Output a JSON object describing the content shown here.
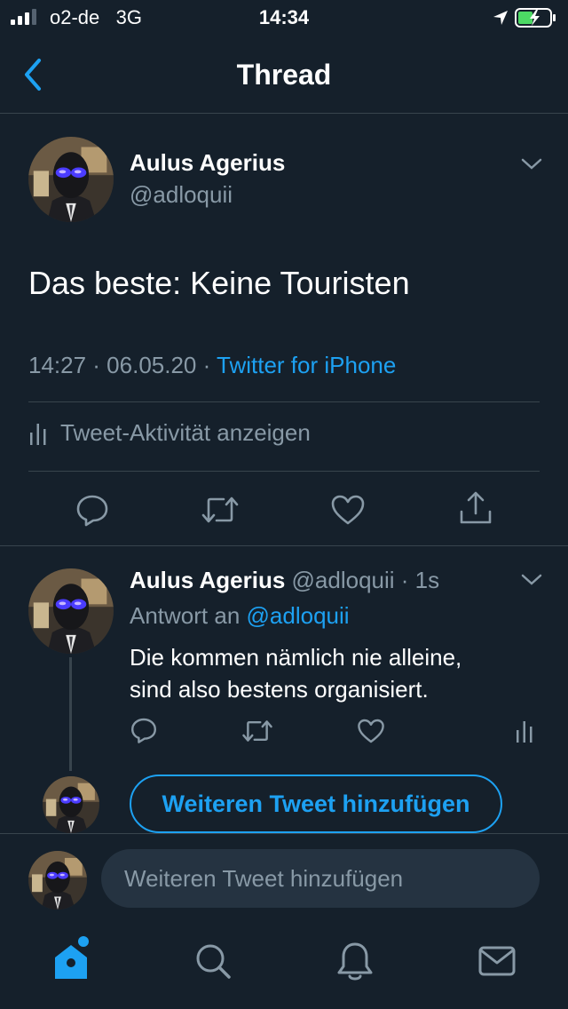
{
  "status_bar": {
    "carrier": "o2-de",
    "network": "3G",
    "time": "14:34"
  },
  "nav": {
    "title": "Thread"
  },
  "tweet": {
    "author_name": "Aulus Agerius",
    "author_handle": "@adloquii",
    "text": "Das beste: Keine Touristen",
    "timestamp": "14:27 · 06.05.20 · ",
    "source": "Twitter for iPhone",
    "activity_label": "Tweet-Aktivität anzeigen"
  },
  "reply": {
    "author_name": "Aulus Agerius",
    "author_handle": "@adloquii · 1s",
    "reply_to_prefix": "Antwort an ",
    "reply_to_mention": "@adloquii",
    "text_line1": "Die kommen nämlich nie alleine,",
    "text_line2": "sind also bestens organisiert."
  },
  "add_tweet_button": "Weiteren Tweet hinzufügen",
  "composer": {
    "placeholder": "Weiteren Tweet hinzufügen"
  },
  "colors": {
    "background": "#15202b",
    "accent": "#1da1f2",
    "secondary_text": "#8899a6",
    "divider": "#38444d",
    "battery": "#4cd964"
  },
  "icons": {
    "status": [
      "signal-icon",
      "location-arrow-icon",
      "battery-charging-icon"
    ],
    "nav": [
      "back-chevron-icon"
    ],
    "tweet_actions": [
      "reply-icon",
      "retweet-icon",
      "like-icon",
      "share-icon"
    ],
    "reply_actions": [
      "reply-icon",
      "retweet-icon",
      "like-icon",
      "activity-icon"
    ],
    "tabs": [
      "home-icon",
      "search-icon",
      "notifications-icon",
      "messages-icon"
    ]
  }
}
